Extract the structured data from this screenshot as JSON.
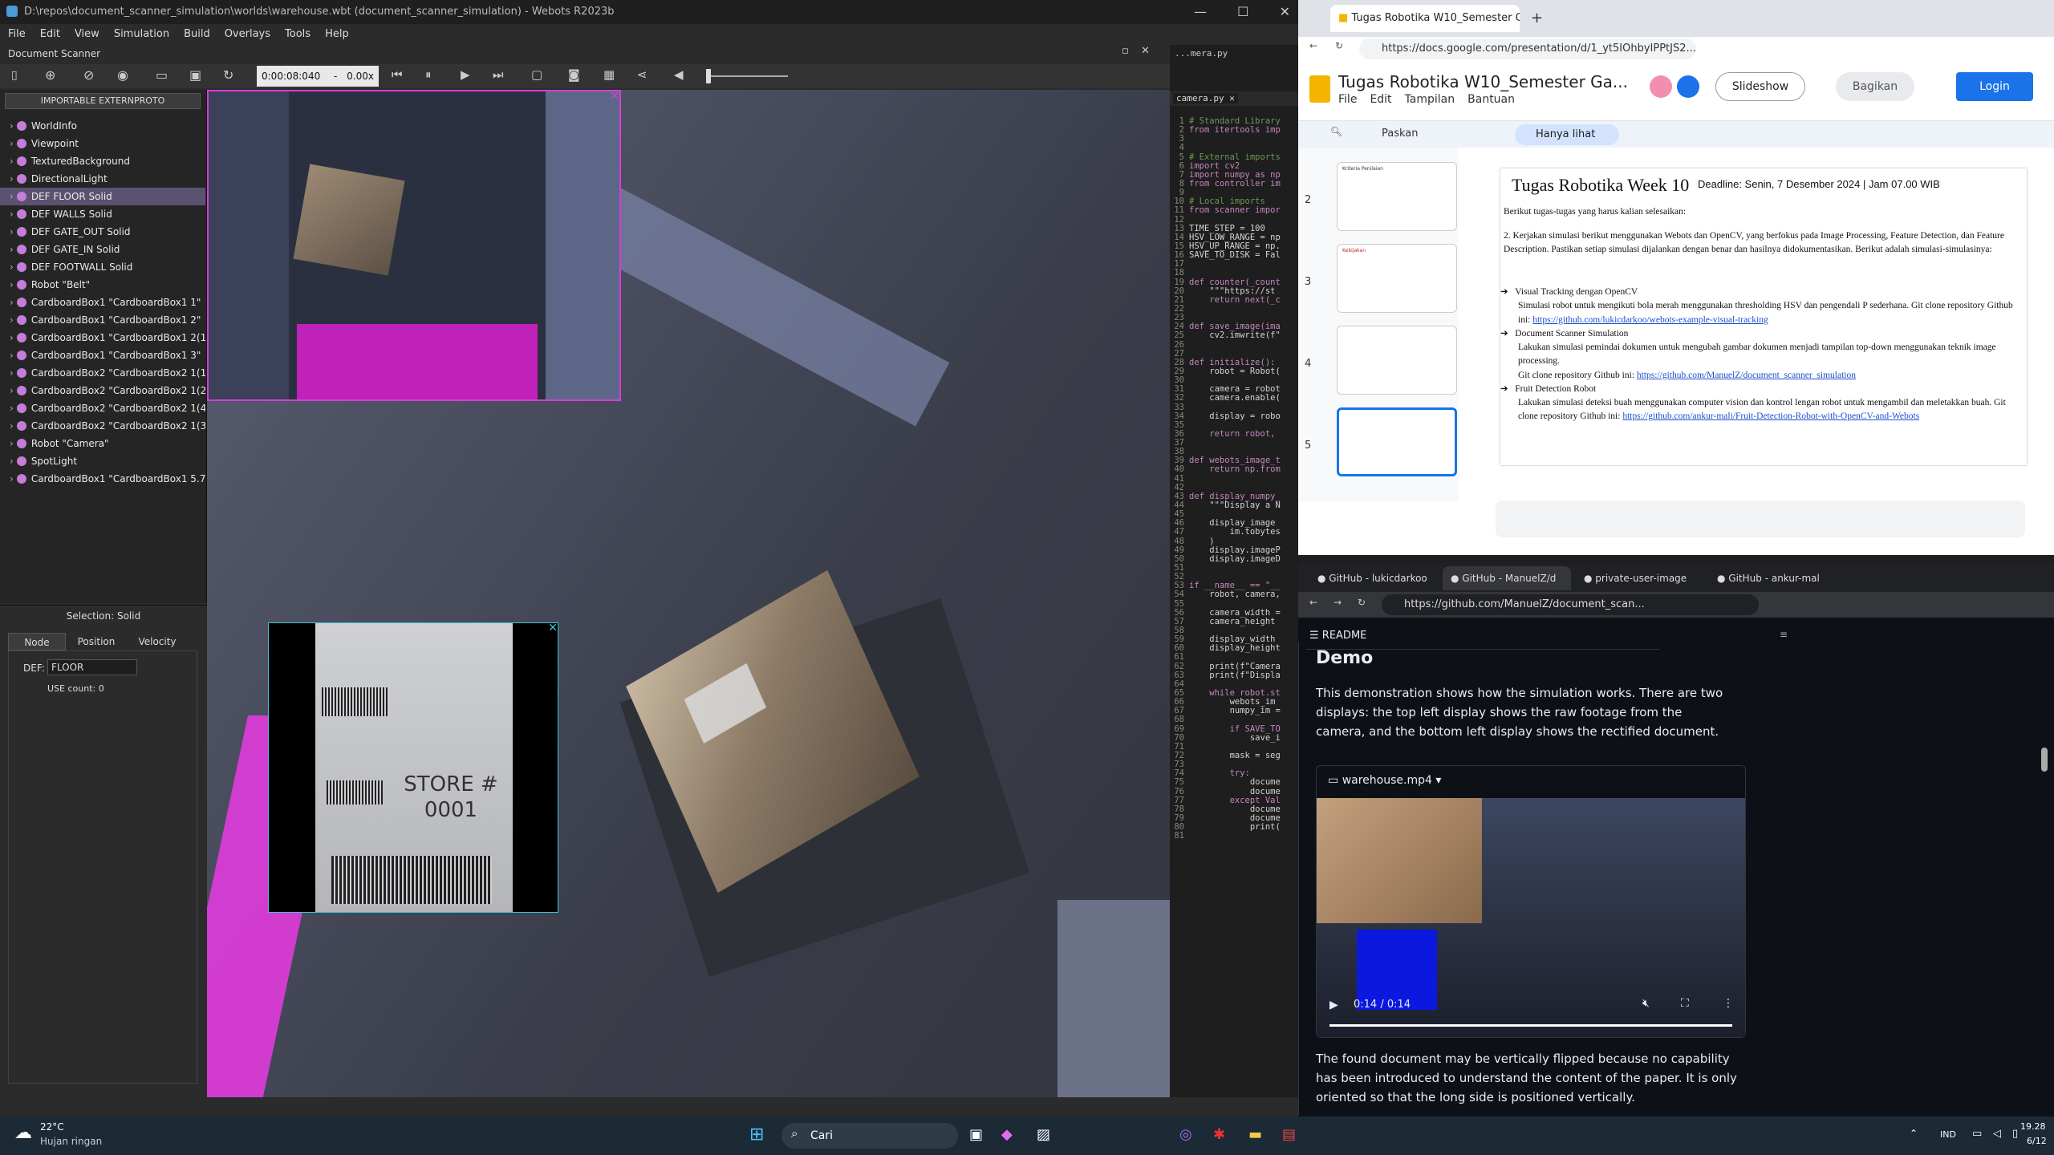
{
  "webots": {
    "title": "D:\\repos\\document_scanner_simulation\\worlds\\warehouse.wbt (document_scanner_simulation) - Webots R2023b",
    "menu": [
      "File",
      "Edit",
      "View",
      "Simulation",
      "Build",
      "Overlays",
      "Tools",
      "Help"
    ],
    "panel_title": "Document Scanner",
    "sim_time": "0:00:08:040",
    "speed": "0.00x",
    "extern_button": "IMPORTABLE EXTERNPROTO",
    "tree": [
      "WorldInfo",
      "Viewpoint",
      "TexturedBackground",
      "DirectionalLight",
      "DEF FLOOR Solid",
      "DEF WALLS Solid",
      "DEF GATE_OUT Solid",
      "DEF GATE_IN Solid",
      "DEF FOOTWALL Solid",
      "Robot \"Belt\"",
      "CardboardBox1 \"CardboardBox1 1\"",
      "CardboardBox1 \"CardboardBox1 2\"",
      "CardboardBox1 \"CardboardBox1 2(1)\"",
      "CardboardBox1 \"CardboardBox1 3\"",
      "CardboardBox2 \"CardboardBox2 1(1)\"",
      "CardboardBox2 \"CardboardBox2 1(2)\"",
      "CardboardBox2 \"CardboardBox2 1(4)\"",
      "CardboardBox2 \"CardboardBox2 1(3)\"",
      "Robot \"Camera\"",
      "SpotLight",
      "CardboardBox1 \"CardboardBox1 5.74213\""
    ],
    "selection": "Selection: Solid",
    "tabs": [
      "Node",
      "Position",
      "Velocity"
    ],
    "def_label": "DEF:",
    "def_value": "FLOOR",
    "use_count": "USE count: 0",
    "editor_tab_short": "...mera.py",
    "editor_tab": "camera.py",
    "doc_overlay": {
      "store": "STORE #",
      "num": "0001"
    },
    "code": [
      [
        "1",
        "# Standard Library"
      ],
      [
        "2",
        "from itertools imp"
      ],
      [
        "3",
        ""
      ],
      [
        "4",
        ""
      ],
      [
        "5",
        "# External imports"
      ],
      [
        "6",
        "import cv2"
      ],
      [
        "7",
        "import numpy as np"
      ],
      [
        "8",
        "from controller im"
      ],
      [
        "9",
        ""
      ],
      [
        "10",
        "# Local imports"
      ],
      [
        "11",
        "from scanner impor"
      ],
      [
        "12",
        ""
      ],
      [
        "13",
        "TIME_STEP = 100"
      ],
      [
        "14",
        "HSV_LOW_RANGE = np"
      ],
      [
        "15",
        "HSV_UP_RANGE = np."
      ],
      [
        "16",
        "SAVE_TO_DISK = Fal"
      ],
      [
        "17",
        ""
      ],
      [
        "18",
        ""
      ],
      [
        "19",
        "def counter(_count"
      ],
      [
        "20",
        "    \"\"\"https://st"
      ],
      [
        "21",
        "    return next(_c"
      ],
      [
        "22",
        ""
      ],
      [
        "23",
        ""
      ],
      [
        "24",
        "def save_image(ima"
      ],
      [
        "25",
        "    cv2.imwrite(f\""
      ],
      [
        "26",
        ""
      ],
      [
        "27",
        ""
      ],
      [
        "28",
        "def initialize():"
      ],
      [
        "29",
        "    robot = Robot("
      ],
      [
        "30",
        ""
      ],
      [
        "31",
        "    camera = robot"
      ],
      [
        "32",
        "    camera.enable("
      ],
      [
        "33",
        ""
      ],
      [
        "34",
        "    display = robo"
      ],
      [
        "35",
        ""
      ],
      [
        "36",
        "    return robot,"
      ],
      [
        "37",
        ""
      ],
      [
        "38",
        ""
      ],
      [
        "39",
        "def webots_image_t"
      ],
      [
        "40",
        "    return np.from"
      ],
      [
        "41",
        ""
      ],
      [
        "42",
        ""
      ],
      [
        "43",
        "def display_numpy_"
      ],
      [
        "44",
        "    \"\"\"Display a N"
      ],
      [
        "45",
        ""
      ],
      [
        "46",
        "    display_image"
      ],
      [
        "47",
        "        im.tobytes"
      ],
      [
        "48",
        "    )"
      ],
      [
        "49",
        "    display.imageP"
      ],
      [
        "50",
        "    display.imageD"
      ],
      [
        "51",
        ""
      ],
      [
        "52",
        ""
      ],
      [
        "53",
        "if __name__ == \"__"
      ],
      [
        "54",
        "    robot, camera,"
      ],
      [
        "55",
        ""
      ],
      [
        "56",
        "    camera_width ="
      ],
      [
        "57",
        "    camera_height"
      ],
      [
        "58",
        ""
      ],
      [
        "59",
        "    display_width"
      ],
      [
        "60",
        "    display_height"
      ],
      [
        "61",
        ""
      ],
      [
        "62",
        "    print(f\"Camera"
      ],
      [
        "63",
        "    print(f\"Displa"
      ],
      [
        "64",
        ""
      ],
      [
        "65",
        "    while robot.st"
      ],
      [
        "66",
        "        webots_im"
      ],
      [
        "67",
        "        numpy_im ="
      ],
      [
        "68",
        ""
      ],
      [
        "69",
        "        if SAVE_TO"
      ],
      [
        "70",
        "            save_i"
      ],
      [
        "71",
        ""
      ],
      [
        "72",
        "        mask = seg"
      ],
      [
        "73",
        ""
      ],
      [
        "74",
        "        try:"
      ],
      [
        "75",
        "            docume"
      ],
      [
        "76",
        "            docume"
      ],
      [
        "77",
        "        except Val"
      ],
      [
        "78",
        "            docume"
      ],
      [
        "79",
        "            docume"
      ],
      [
        "80",
        "            print("
      ],
      [
        "81",
        ""
      ]
    ]
  },
  "slides": {
    "tab_title": "Tugas Robotika W10_Semester Ga",
    "url": "https://docs.google.com/presentation/d/1_yt5IOhbyIPPtJS2...",
    "doc_title": "Tugas Robotika W10_Semester Ga...",
    "menu": [
      "File",
      "Edit",
      "Tampilan",
      "Bantuan"
    ],
    "slideshow": "Slideshow",
    "share": "Bagikan",
    "login": "Login",
    "zoom_label": "Paskan",
    "view_only": "Hanya lihat",
    "thumb_nums": [
      "2",
      "3",
      "4",
      "5"
    ],
    "thumb2_title": "Kriteria Penilaian",
    "thumb3_title": "Kebijakan",
    "slide_title": "Tugas Robotika Week 10",
    "deadline": "Deadline: Senin, 7 Desember 2024  | Jam 07.00 WIB",
    "intro": "Berikut tugas-tugas yang harus kalian selesaikan:",
    "item2": "2.  Kerjakan simulasi berikut menggunakan Webots dan OpenCV, yang berfokus pada Image Processing, Feature Detection, dan Feature Description. Pastikan setiap simulasi dijalankan dengan benar dan hasilnya didokumentasikan. Berikut adalah simulasi-simulasinya:",
    "b1_title": "Visual Tracking dengan OpenCV",
    "b1_text": "Simulasi robot untuk mengikuti bola merah menggunakan thresholding HSV dan pengendali P sederhana. Git clone repository Github ini: ",
    "b1_link": "https://github.com/lukicdarkoo/webots-example-visual-tracking",
    "b2_title": "Document Scanner Simulation",
    "b2_text": "Lakukan simulasi pemindai dokumen untuk mengubah gambar dokumen menjadi tampilan top-down menggunakan teknik image processing.",
    "b2_pre": "Git clone repository Github ini: ",
    "b2_link": "https://github.com/ManuelZ/document_scanner_simulation",
    "b3_title": "Fruit Detection Robot",
    "b3_text": "Lakukan simulasi deteksi buah menggunakan computer vision dan kontrol lengan robot untuk mengambil dan meletakkan buah. Git clone repository Github ini: ",
    "b3_link": "https://github.com/ankur-mali/Fruit-Detection-Robot-with-OpenCV-and-Webots"
  },
  "github": {
    "tabs": [
      "GitHub - lukicdarkoo",
      "GitHub - ManuelZ/d",
      "private-user-image",
      "GitHub - ankur-mal"
    ],
    "url": "https://github.com/ManuelZ/document_scan...",
    "readme": "README",
    "h2": "Demo",
    "p1": "This demonstration shows how the simulation works. There are two displays: the top left display shows the raw footage from the camera, and the bottom left display shows the rectified document.",
    "video_name": "warehouse.mp4",
    "video_time": "0:14 / 0:14",
    "p2": "The found document may be vertically flipped because no capability has been introduced to understand the content of the paper. It is only oriented so that the long side is positioned vertically."
  },
  "taskbar": {
    "temp": "22°C",
    "weather": "Hujan ringan",
    "search": "Cari",
    "lang": "IND",
    "time": "19.28",
    "date": "6/12"
  },
  "colors": {
    "accent": "#1a73e8",
    "tree_dot": "#c67cd9",
    "magenta": "#d93cd6",
    "cyan": "#3fc2d8"
  }
}
